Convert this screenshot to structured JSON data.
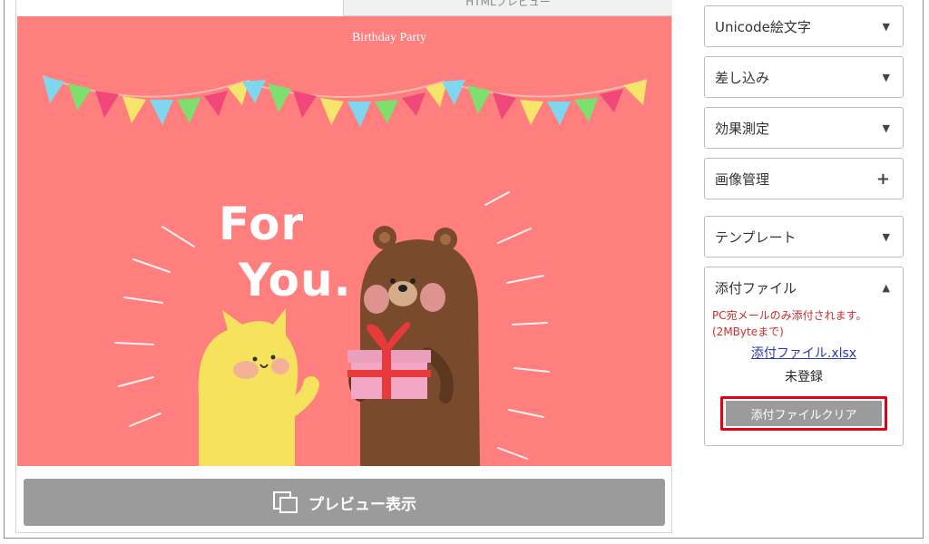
{
  "top_tab": {
    "label": "HTMLプレビュー"
  },
  "card": {
    "title": "Birthday Party",
    "headline_line1": "For",
    "headline_line2": "You."
  },
  "preview_button": {
    "label": "プレビュー表示",
    "icon": "preview-window-icon"
  },
  "sidebar": {
    "panels": [
      {
        "label": "Unicode絵文字",
        "icon": "triangle-down-icon"
      },
      {
        "label": "差し込み",
        "icon": "triangle-down-icon"
      },
      {
        "label": "効果測定",
        "icon": "triangle-down-icon"
      },
      {
        "label": "画像管理",
        "icon": "plus-icon"
      },
      {
        "label": "テンプレート",
        "icon": "triangle-down-icon"
      }
    ],
    "attachment": {
      "label": "添付ファイル",
      "icon": "triangle-up-icon",
      "note_line1": "PC宛メールのみ添付されます。",
      "note_line2": "(2MByteまで)",
      "file_link": "添付ファイル.xlsx",
      "status": "未登録",
      "clear_button": "添付ファイルクリア"
    }
  },
  "colors": {
    "card_bg": "#fe7f7e",
    "button_gray": "#9b9b9b",
    "highlight_red": "#e60012",
    "note_red": "#d12b2b"
  }
}
